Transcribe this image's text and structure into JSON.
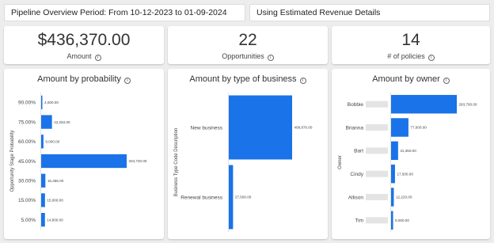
{
  "header": {
    "period_text": "Pipeline Overview Period: From 10-12-2023 to 01-09-2024",
    "revenue_text": "Using Estimated Revenue Details"
  },
  "kpis": [
    {
      "value": "$436,370.00",
      "label": "Amount"
    },
    {
      "value": "22",
      "label": "Opportunities"
    },
    {
      "value": "14",
      "label": "# of policies"
    }
  ],
  "icons": {
    "info": "info-icon"
  },
  "colors": {
    "bar": "#1a73e8",
    "placeholder": "#e4e4e4",
    "background": "#ededed",
    "card": "#ffffff"
  },
  "chart_data": [
    {
      "type": "bar",
      "orientation": "horizontal",
      "title": "Amount by probability",
      "ylabel": "Opportunity Stage Probability",
      "categories": [
        "90.00%",
        "75.00%",
        "60.00%",
        "45.00%",
        "30.00%",
        "15.00%",
        "5.00%"
      ],
      "values": [
        4000,
        42284,
        9000,
        334720,
        16466,
        15000,
        14800
      ],
      "data_labels": [
        "4,000.00",
        "42,284.00",
        "9,000.00",
        "334,720.00",
        "16,466.00",
        "15,000.00",
        "14,800.00"
      ]
    },
    {
      "type": "bar",
      "orientation": "horizontal",
      "title": "Amount by type of business",
      "ylabel": "Business Type Code Description",
      "categories": [
        "New business",
        "Renewal business"
      ],
      "values": [
        408870,
        27500
      ],
      "data_labels": [
        "408,870.00",
        "27,500.00"
      ]
    },
    {
      "type": "bar",
      "orientation": "horizontal",
      "title": "Amount by owner",
      "ylabel": "Owner",
      "categories": [
        "Bobbie",
        "Brianna",
        "Bart",
        "Cindy",
        "Allison",
        "Tim"
      ],
      "values": [
        293700,
        77600,
        31350,
        17500,
        12220,
        9000
      ],
      "data_labels": [
        "293,700.00",
        "77,600.00",
        "31,350.00",
        "17,500.00",
        "12,220.00",
        "9,000.00"
      ]
    }
  ]
}
